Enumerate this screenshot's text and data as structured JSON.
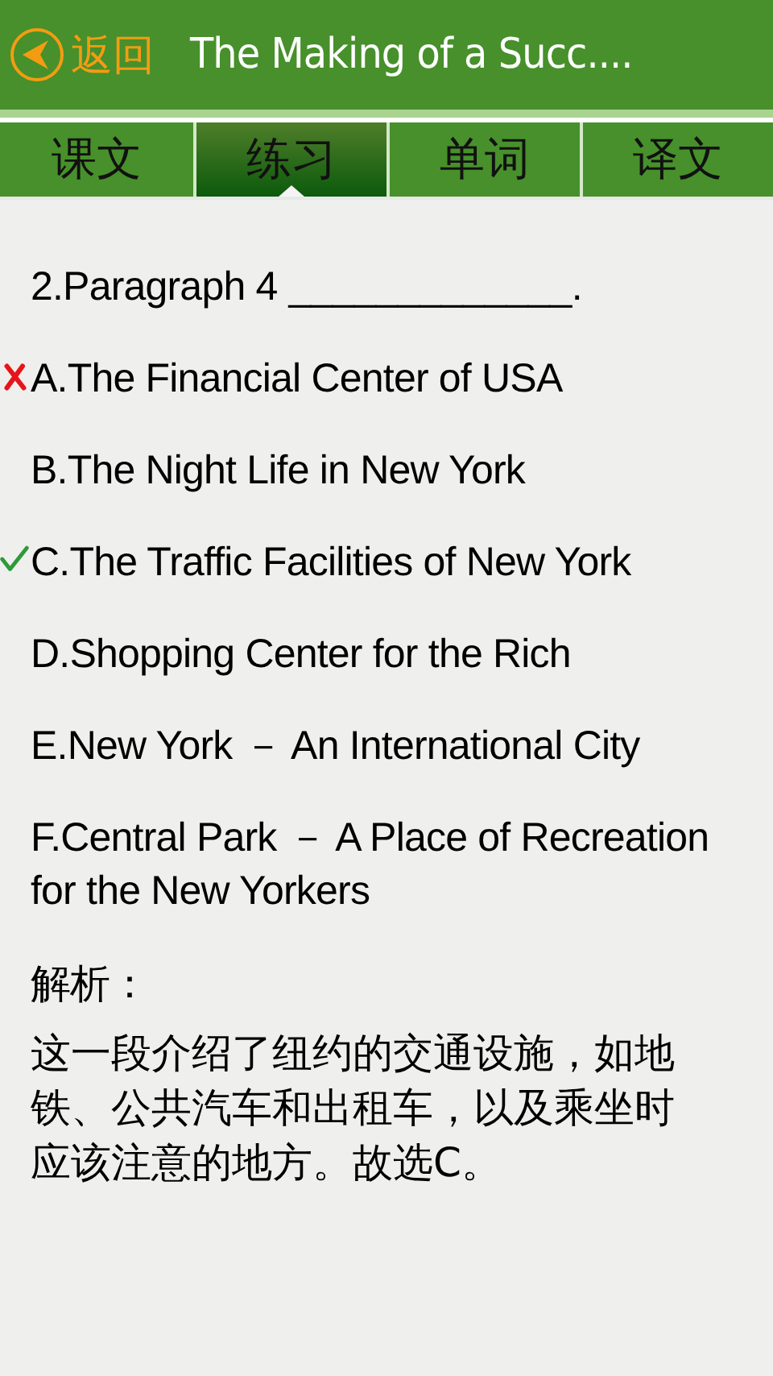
{
  "header": {
    "back_label": "返回",
    "title": "The Making of a Succ...."
  },
  "tabs": [
    {
      "label": "课文",
      "selected": false
    },
    {
      "label": "练习",
      "selected": true
    },
    {
      "label": "单词",
      "selected": false
    },
    {
      "label": "译文",
      "selected": false
    }
  ],
  "question": {
    "prompt": "2.Paragraph 4",
    "blank": "_____________",
    "end": "."
  },
  "options": [
    {
      "text": "A.The Financial Center of USA",
      "wrong": true,
      "correct": false
    },
    {
      "text": "B.The Night Life in New York",
      "wrong": false,
      "correct": false
    },
    {
      "text": "C.The Traffic Facilities of New York",
      "wrong": false,
      "correct": true
    },
    {
      "text": "D.Shopping Center for the Rich",
      "wrong": false,
      "correct": false
    },
    {
      "text": "E.New York － An International City",
      "wrong": false,
      "correct": false
    },
    {
      "text": "F.Central Park － A Place of Recreation for the New Yorkers",
      "wrong": false,
      "correct": false
    }
  ],
  "analysis": {
    "label": "解析：",
    "text": "这一段介绍了纽约的交通设施，如地铁、公共汽车和出租车，以及乘坐时应该注意的地方。故选C。"
  }
}
